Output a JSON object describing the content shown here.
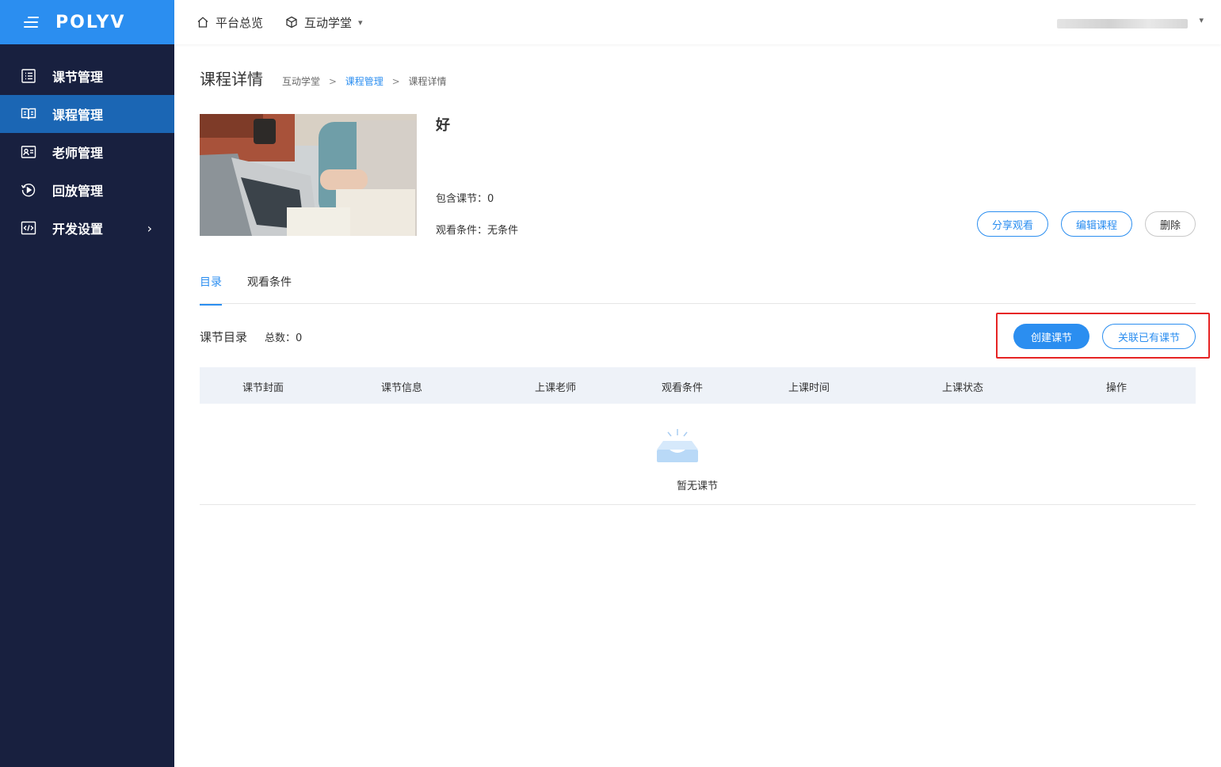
{
  "brand": {
    "logo_text": "POLYV",
    "accent": "#2b8ef0",
    "sidebar_bg": "#18203f",
    "active_bg": "#1b66b4",
    "highlight": "#e62424"
  },
  "sidebar": {
    "items": [
      {
        "label": "课节管理",
        "icon": "list-icon"
      },
      {
        "label": "课程管理",
        "icon": "book-icon",
        "active": true
      },
      {
        "label": "老师管理",
        "icon": "id-card-icon"
      },
      {
        "label": "回放管理",
        "icon": "replay-icon"
      },
      {
        "label": "开发设置",
        "icon": "code-icon",
        "has_submenu": true
      }
    ]
  },
  "header": {
    "home_label": "平台总览",
    "product_label": "互动学堂",
    "submenu_arrow": "▾"
  },
  "page": {
    "title": "课程详情",
    "breadcrumb": [
      "互动学堂",
      "课程管理",
      "课程详情"
    ],
    "breadcrumb_sep": ">"
  },
  "course": {
    "name": "好",
    "lessons_label": "包含课节：0",
    "condition_label": "观看条件：无条件",
    "actions": {
      "share": "分享观看",
      "edit": "编辑课程",
      "delete": "删除"
    }
  },
  "tabs": [
    {
      "label": "目录",
      "active": true
    },
    {
      "label": "观看条件"
    }
  ],
  "catalog": {
    "title": "课节目录",
    "total_label": "总数：0",
    "create_button": "创建课节",
    "link_button": "关联已有课节"
  },
  "table": {
    "columns": [
      "课节封面",
      "课节信息",
      "上课老师",
      "观看条件",
      "上课时间",
      "上课状态",
      "操作"
    ],
    "rows": [],
    "empty_text": "暂无课节"
  }
}
